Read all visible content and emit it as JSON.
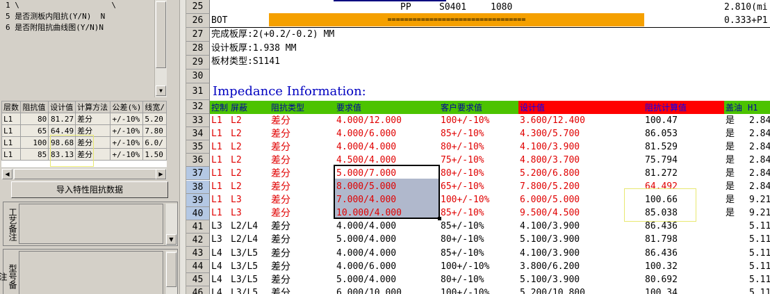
{
  "left_panel": {
    "list_items": [
      "1 \\                    \\",
      "5 是否测板内阻抗(Y/N)  N",
      "6 是否附阻抗曲线图(Y/N)N"
    ],
    "grid_headers": [
      "层数",
      "阻抗值",
      "设计值",
      "计算方法",
      "公差(%)",
      "线宽/"
    ],
    "grid_rows": [
      [
        "L1",
        "80",
        "81.27",
        "差分",
        "+/-10%",
        "5.20"
      ],
      [
        "L1",
        "65",
        "64.49",
        "差分",
        "+/-10%",
        "7.80"
      ],
      [
        "L1",
        "100",
        "98.68",
        "差分",
        "+/-10%",
        "6.0/"
      ],
      [
        "L1",
        "85",
        "83.13",
        "差分",
        "+/-10%",
        "1.50"
      ]
    ],
    "import_button": "导入特性阻抗数据",
    "memo1_label": "工艺备注",
    "memo2_label": "型号备注"
  },
  "sheet": {
    "row25": {
      "num": "25",
      "pp": "PP",
      "code": "S0401",
      "val": "1080",
      "right": "2.810(mi"
    },
    "row26": {
      "num": "26",
      "bot": "BOT",
      "bar": "=================================",
      "right": "0.333+P1"
    },
    "row27": {
      "num": "27",
      "text": "完成板厚:2(+0.2/-0.2) MM"
    },
    "row28": {
      "num": "28",
      "text": "设计板厚:1.938 MM"
    },
    "row29": {
      "num": "29",
      "text": "板材类型:S1141"
    },
    "row30": {
      "num": "30"
    },
    "row31": {
      "num": "31",
      "text": "Impedance Information:"
    },
    "header": {
      "num": "32",
      "c1": "控制",
      "c2": "屏蔽",
      "c3": "阻抗类型",
      "c4": "要求值",
      "c5": "客户要求值",
      "c6": "设计值",
      "c7": "阻抗计算值",
      "c8": "盖油",
      "c9": "H1"
    },
    "rows": [
      {
        "num": "33",
        "ctrl": "L1",
        "shield": "L2",
        "type": "差分",
        "req": "4.000/12.000",
        "cust": "100+/-10%",
        "design": "3.600/12.400",
        "calc": "100.47",
        "oil": "是",
        "h1": "2.84"
      },
      {
        "num": "34",
        "ctrl": "L1",
        "shield": "L2",
        "type": "差分",
        "req": "4.000/6.000",
        "cust": "85+/-10%",
        "design": "4.300/5.700",
        "calc": "86.053",
        "oil": "是",
        "h1": "2.84"
      },
      {
        "num": "35",
        "ctrl": "L1",
        "shield": "L2",
        "type": "差分",
        "req": "4.000/4.000",
        "cust": "80+/-10%",
        "design": "4.100/3.900",
        "calc": "81.529",
        "oil": "是",
        "h1": "2.84"
      },
      {
        "num": "36",
        "ctrl": "L1",
        "shield": "L2",
        "type": "差分",
        "req": "4.500/4.000",
        "cust": "75+/-10%",
        "design": "4.800/3.700",
        "calc": "75.794",
        "oil": "是",
        "h1": "2.84"
      },
      {
        "num": "37",
        "ctrl": "L1",
        "shield": "L2",
        "type": "差分",
        "req": "5.000/7.000",
        "cust": "80+/-10%",
        "design": "5.200/6.800",
        "calc": "81.272",
        "oil": "是",
        "h1": "2.84"
      },
      {
        "num": "38",
        "ctrl": "L1",
        "shield": "L2",
        "type": "差分",
        "req": "8.000/5.000",
        "cust": "65+/-10%",
        "design": "7.800/5.200",
        "calc": "64.492",
        "oil": "是",
        "h1": "2.84"
      },
      {
        "num": "39",
        "ctrl": "L1",
        "shield": "L3",
        "type": "差分",
        "req": "7.000/4.000",
        "cust": "100+/-10%",
        "design": "6.000/5.000",
        "calc": "100.66",
        "oil": "是",
        "h1": "9.21"
      },
      {
        "num": "40",
        "ctrl": "L1",
        "shield": "L3",
        "type": "差分",
        "req": "10.000/4.000",
        "cust": "85+/-10%",
        "design": "9.500/4.500",
        "calc": "85.038",
        "oil": "是",
        "h1": "9.21"
      },
      {
        "num": "41",
        "ctrl": "L3",
        "shield": "L2/L4",
        "type": "差分",
        "req": "4.000/4.000",
        "cust": "85+/-10%",
        "design": "4.100/3.900",
        "calc": "86.436",
        "oil": "",
        "h1": "5.11"
      },
      {
        "num": "42",
        "ctrl": "L3",
        "shield": "L2/L4",
        "type": "差分",
        "req": "5.000/4.000",
        "cust": "80+/-10%",
        "design": "5.100/3.900",
        "calc": "81.798",
        "oil": "",
        "h1": "5.11"
      },
      {
        "num": "43",
        "ctrl": "L4",
        "shield": "L3/L5",
        "type": "差分",
        "req": "4.000/4.000",
        "cust": "85+/-10%",
        "design": "4.100/3.900",
        "calc": "86.436",
        "oil": "",
        "h1": "5.11"
      },
      {
        "num": "44",
        "ctrl": "L4",
        "shield": "L3/L5",
        "type": "差分",
        "req": "4.000/6.000",
        "cust": "100+/-10%",
        "design": "3.800/6.200",
        "calc": "100.32",
        "oil": "",
        "h1": "5.11"
      },
      {
        "num": "45",
        "ctrl": "L4",
        "shield": "L3/L5",
        "type": "差分",
        "req": "5.000/4.000",
        "cust": "80+/-10%",
        "design": "5.100/3.900",
        "calc": "80.692",
        "oil": "",
        "h1": "5.11"
      },
      {
        "num": "46",
        "ctrl": "L4",
        "shield": "L3/L5",
        "type": "差分",
        "req": "6.000/10.000",
        "cust": "100+/-10%",
        "design": "5.200/10.800",
        "calc": "100.34",
        "oil": "",
        "h1": "5.11"
      }
    ]
  },
  "colors": {
    "orange_bar": "#f5a000",
    "header_green": "#4cc300",
    "header_red": "#ff0000",
    "selection": "#b0b8cc",
    "highlight_box": "#e8e870"
  }
}
